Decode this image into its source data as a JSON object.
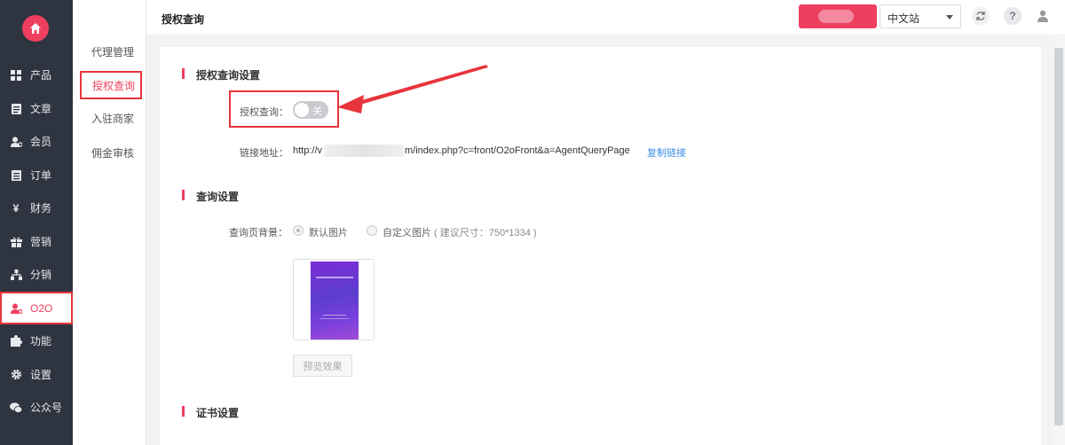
{
  "nav": {
    "items": [
      {
        "label": "产品",
        "icon": "grid-icon"
      },
      {
        "label": "文章",
        "icon": "article-icon"
      },
      {
        "label": "会员",
        "icon": "member-icon"
      },
      {
        "label": "订单",
        "icon": "order-icon"
      },
      {
        "label": "财务",
        "icon": "yen-icon"
      },
      {
        "label": "营销",
        "icon": "gift-icon"
      },
      {
        "label": "分销",
        "icon": "hierarchy-icon"
      },
      {
        "label": "O2O",
        "icon": "o2o-icon"
      },
      {
        "label": "功能",
        "icon": "puzzle-icon"
      },
      {
        "label": "设置",
        "icon": "gear-icon"
      },
      {
        "label": "公众号",
        "icon": "wechat-icon"
      }
    ]
  },
  "subnav": {
    "items": [
      "代理管理",
      "授权查询",
      "入驻商家",
      "佣金审核"
    ]
  },
  "header": {
    "title": "授权查询",
    "site_select": "中文站"
  },
  "sections": {
    "auth": {
      "title": "授权查询设置",
      "toggle_label": "授权查询：",
      "toggle_state": "关",
      "link_label": "链接地址：",
      "link_prefix": "http://v",
      "link_suffix": "m/index.php?c=front/O2oFront&a=AgentQueryPage",
      "copy_link": "复制链接"
    },
    "query": {
      "title": "查询设置",
      "bg_label": "查询页背景：",
      "option_default": "默认图片",
      "option_custom": "自定义图片",
      "size_hint": "( 建议尺寸：750*1334 )",
      "preview_button": "预览效果"
    },
    "cert": {
      "title": "证书设置"
    }
  },
  "colors": {
    "accent": "#ef3f5f",
    "nav_bg": "#2f3540",
    "highlight": "#e8343c",
    "link": "#3a8ee6"
  }
}
